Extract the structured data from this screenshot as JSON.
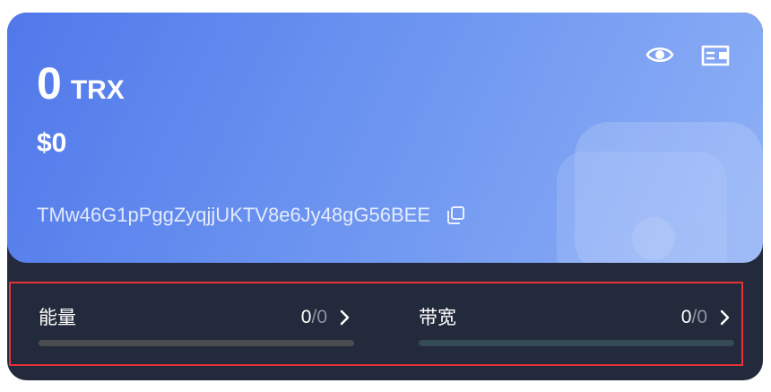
{
  "balance": {
    "amount": "0",
    "unit": "TRX",
    "fiat": "$0"
  },
  "address": {
    "text": "TMw46G1pPggZyqjjUKTV8e6Jy48gG56BEE"
  },
  "icons": {
    "visibility": "eye-icon",
    "wallet": "wallet-icon",
    "copy": "copy-icon",
    "chevron": "chevron-right-icon"
  },
  "resources": [
    {
      "label": "能量",
      "used": "0",
      "separator": "/",
      "total": "0",
      "fill": 0,
      "track_color": "#4a4c50"
    },
    {
      "label": "带宽",
      "used": "0",
      "separator": "/",
      "total": "0",
      "fill": 0,
      "track_color": "#344a55"
    }
  ],
  "colors": {
    "card_background": "#232a3b",
    "gradient_start": "#5178ea",
    "gradient_end": "#8fb0f6",
    "highlight_border": "#e8323a"
  }
}
